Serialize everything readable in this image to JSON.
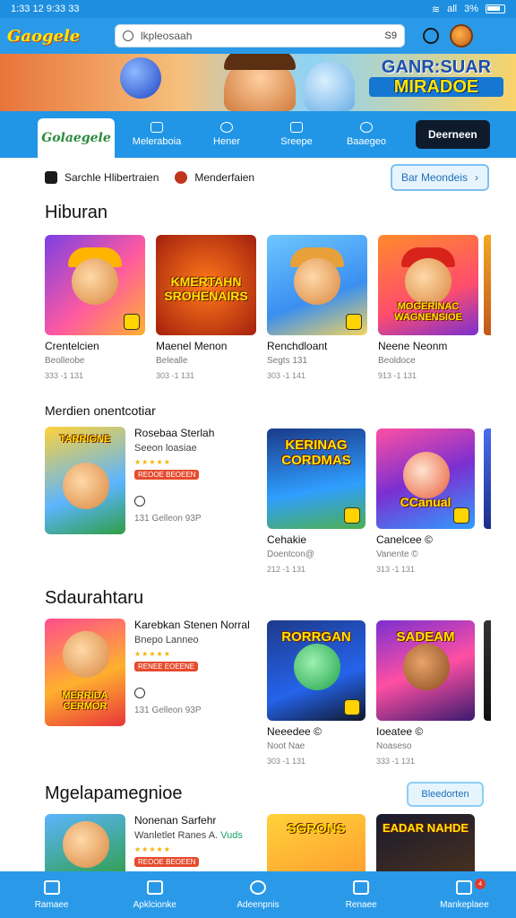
{
  "status": {
    "time": "1:33 12 9:33 33",
    "signal": "all",
    "battery": "3%"
  },
  "topbar": {
    "logo": "Gaogele",
    "search_placeholder": "lkpleosaah",
    "search_mic": "S9"
  },
  "banner": {
    "title_line1": "GANR:SUAR",
    "title_line2": "MIRADOE"
  },
  "nav": {
    "logo": "Golaegele",
    "items": [
      "Meleraboia",
      "Hener",
      "Sreepe",
      "Baaegeo"
    ],
    "cta": "Deerneen"
  },
  "filter": {
    "items": [
      "Sarchle Hlibertraien",
      "Menderfaien"
    ],
    "button": "Bar Meondeis",
    "button_arrow": "›"
  },
  "hiburan": {
    "title": "Hiburan",
    "cards": [
      {
        "thumb_text": "",
        "name": "Crentelcien",
        "meta": "Beolleobe",
        "meta2": "333 -1 131"
      },
      {
        "thumb_text": "KMERTAHN SROHENAIRS",
        "name": "Maenel Menon",
        "meta": "Belealle",
        "meta2": "303 -1 131"
      },
      {
        "thumb_text": "",
        "name": "Renchdloant",
        "meta": "Segts 131",
        "meta2": "303 -1 141"
      },
      {
        "thumb_text": "MOGERINAC WAGNENSIOE",
        "name": "Neene Neonm",
        "meta": "Beoldoce",
        "meta2": "913 -1 131"
      }
    ]
  },
  "rekomendasi": {
    "title": "Merdien onentcotiar",
    "feature": {
      "thumb_text": "TARRIGNE",
      "title": "Rosebaa Sterlah",
      "subtitle": "Seeon loasiae",
      "stars": "★★★★★",
      "badge": "REOOE BEOEEN",
      "meta": "131 Gelleon 93P"
    },
    "cards": [
      {
        "thumb_text": "KERINAG CORDMAS",
        "name": "Cehakie",
        "meta": "Doentcon@",
        "meta2": "212 -1 131"
      },
      {
        "thumb_text": "CCanual",
        "name": "Canelcee ©",
        "meta": "Vanente ©",
        "meta2": "313 -1 131"
      }
    ]
  },
  "terbaru": {
    "title": "Sdaurahtaru",
    "feature": {
      "thumb_text": "MERRIDA CERMOR",
      "title": "Karebkan Stenen Norral",
      "subtitle": "Bnepo Lanneo",
      "stars": "★★★★★",
      "badge": "RENEE EOEENE",
      "meta": "131 Gelleon 93P"
    },
    "cards": [
      {
        "thumb_text": "RORRGAN",
        "name": "Neeedee ©",
        "meta": "Noot Nae",
        "meta2": "303 -1 131"
      },
      {
        "thumb_text": "SADEAM",
        "name": "Ioeatee ©",
        "meta": "Noaseso",
        "meta2": "333 -1 131"
      }
    ]
  },
  "populer": {
    "title": "Mgelapamegnioe",
    "more": "Bleedorten",
    "feature": {
      "title": "Nonenan Sarfehr",
      "subtitle": "Wanletlet Ranes A.",
      "extra": "Vuds",
      "stars": "★★★★★",
      "badge": "REOOE BEOEEN"
    },
    "cards": [
      {
        "thumb_text": "SGRONS"
      },
      {
        "thumb_text": "EADAR NAHDE"
      }
    ]
  },
  "bottom": {
    "items": [
      "Ramaee",
      "Apklcionke",
      "Adeenpnis",
      "Renaee",
      "Mankeplaee"
    ],
    "badge": "4"
  }
}
